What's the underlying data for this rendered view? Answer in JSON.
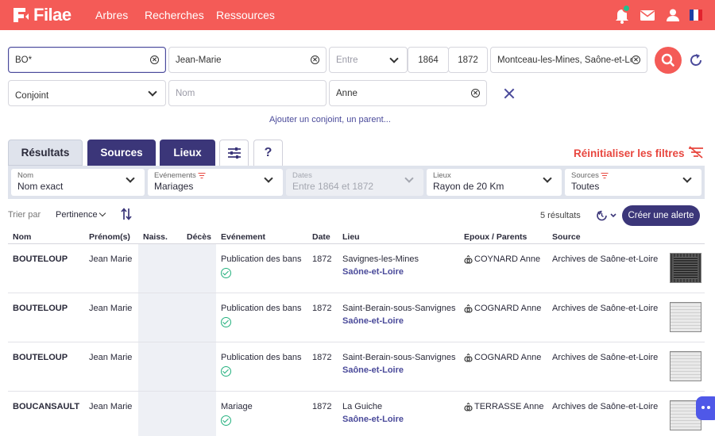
{
  "header": {
    "logo": "Filae",
    "nav": [
      "Arbres",
      "Recherches",
      "Ressources"
    ],
    "icons": [
      "bell-icon",
      "mail-icon",
      "user-icon",
      "french-flag-icon"
    ],
    "colors": {
      "brand": "#f45b57",
      "accent": "#3b3679",
      "notif": "#22c08d"
    }
  },
  "search": {
    "surname": "BO*",
    "firstname": "Jean-Marie",
    "period_mode": "Entre",
    "year_from": "1864",
    "year_to": "1872",
    "place": "Montceau-les-Mines, Saône-et-Loire",
    "relation": "Conjoint",
    "rel_surname_placeholder": "Nom",
    "rel_firstname": "Anne",
    "add_link": "Ajouter un conjoint, un parent..."
  },
  "tabs": {
    "results": "Résultats",
    "sources": "Sources",
    "places": "Lieux",
    "help": "?",
    "reset_filters": "Réinitialiser les filtres"
  },
  "filters": [
    {
      "label": "Nom",
      "value": "Nom exact"
    },
    {
      "label": "Evénements",
      "value": "Mariages"
    },
    {
      "label": "Dates",
      "value": "Entre 1864 et 1872"
    },
    {
      "label": "Lieux",
      "value": "Rayon de 20 Km"
    },
    {
      "label": "Sources",
      "value": "Toutes"
    }
  ],
  "sort": {
    "label": "Trier par",
    "value": "Pertinence",
    "count": "5 résultats",
    "alert_button": "Créer une alerte"
  },
  "table": {
    "columns": [
      "Nom",
      "Prénom(s)",
      "Naiss.",
      "Décès",
      "Evénement",
      "Date",
      "Lieu",
      "Epoux / Parents",
      "Source"
    ],
    "rows": [
      {
        "name": "BOUTELOUP",
        "first": "Jean Marie",
        "event": "Publication des bans",
        "date": "1872",
        "place": "Savignes-les-Mines",
        "region": "Saône-et-Loire",
        "spouse": "COYNARD Anne",
        "source": "Archives de Saône-et-Loire"
      },
      {
        "name": "BOUTELOUP",
        "first": "Jean Marie",
        "event": "Publication des bans",
        "date": "1872",
        "place": "Saint-Berain-sous-Sanvignes",
        "region": "Saône-et-Loire",
        "spouse": "COGNARD Anne",
        "source": "Archives de Saône-et-Loire"
      },
      {
        "name": "BOUTELOUP",
        "first": "Jean Marie",
        "event": "Publication des bans",
        "date": "1872",
        "place": "Saint-Berain-sous-Sanvignes",
        "region": "Saône-et-Loire",
        "spouse": "COGNARD Anne",
        "source": "Archives de Saône-et-Loire"
      },
      {
        "name": "BOUCANSAULT",
        "first": "Jean Marie",
        "event": "Mariage",
        "date": "1872",
        "place": "La Guiche",
        "region": "Saône-et-Loire",
        "spouse": "TERRASSE Anne",
        "source": "Archives de Saône-et-Loire"
      }
    ]
  }
}
